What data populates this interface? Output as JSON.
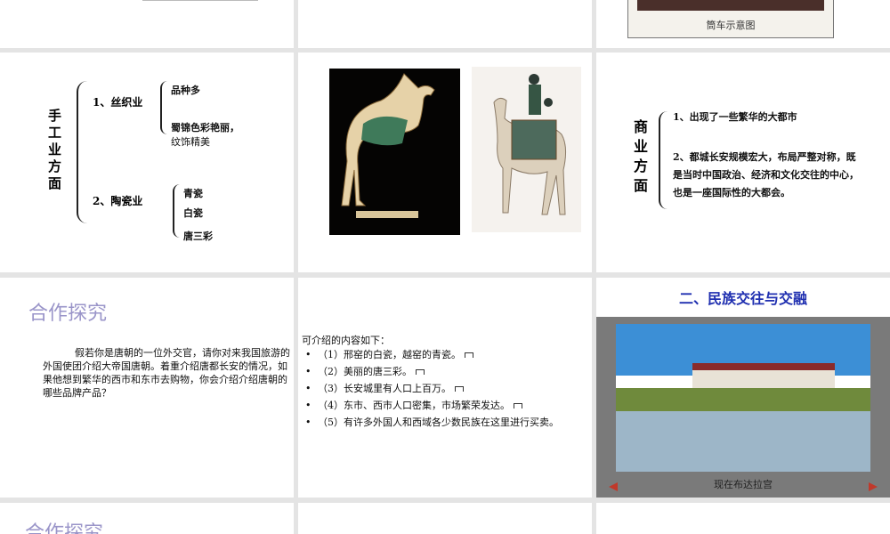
{
  "r1": {
    "caption": "筒车示意图"
  },
  "handicraft": {
    "title": "手工业方面",
    "title_chars": [
      "手",
      "工",
      "业",
      "方",
      "面"
    ],
    "silk_label": "1、丝织业",
    "silk_items": [
      "品种多",
      "蜀锦色彩艳丽，",
      "纹饰精美"
    ],
    "pottery_label": "2、陶瓷业",
    "pottery_items": [
      "青瓷",
      "白瓷",
      "唐三彩"
    ]
  },
  "commerce": {
    "title_chars": [
      "商",
      "业",
      "方",
      "面"
    ],
    "item1": "1、出现了一些繁华的大都市",
    "item2": "2、都城长安规模宏大，布局严整对称，既是当时中国政治、经济和文化交往的中心，也是一座国际性的大都会。"
  },
  "coop": {
    "title": "合作探究",
    "paragraph": "假若你是唐朝的一位外交官，请你对来我国旅游的外国使团介绍大帝国唐朝。着重介绍唐都长安的情况，如果他想到繁华的西市和东市去购物，你会介绍介绍唐朝的哪些品牌产品？"
  },
  "intro": {
    "heading": "可介绍的内容如下：",
    "items": [
      "（1）邢窑的白瓷，越窑的青瓷。",
      "（2）美丽的唐三彩。",
      "（3）长安城里有人口上百万。",
      "（4）东市、西市人口密集，市场繁荣发达。",
      "（5）有许多外国人和西域各少数民族在这里进行买卖。"
    ]
  },
  "ethnic": {
    "title": "二、民族交往与交融",
    "caption": "现在布达拉宫"
  },
  "r4": {
    "title": "合作探究"
  },
  "colors": {
    "title_purple": "#9a95c9",
    "title_blue": "#1f2fb0",
    "frame_red": "#c0392b"
  }
}
